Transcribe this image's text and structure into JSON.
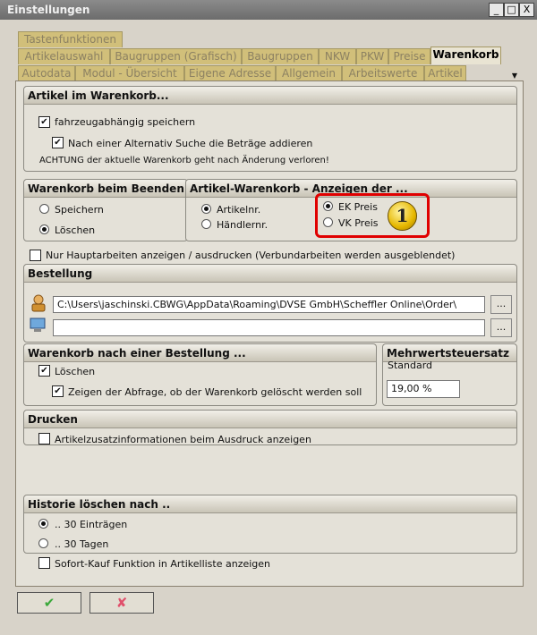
{
  "window": {
    "title": "Einstellungen",
    "controls": [
      "_",
      "□",
      "X"
    ]
  },
  "tabs": {
    "row1": [
      "Tastenfunktionen"
    ],
    "row2": [
      "Artikelauswahl",
      "Baugruppen (Grafisch)",
      "Baugruppen",
      "NKW",
      "PKW",
      "Preise",
      "Warenkorb"
    ],
    "row3": [
      "Autodata",
      "Modul - Übersicht",
      "Eigene Adresse",
      "Allgemein",
      "Arbeitswerte",
      "Artikel"
    ],
    "active": "Warenkorb"
  },
  "artikel_im_warenkorb": {
    "title": "Artikel im Warenkorb...",
    "fahrzeug": {
      "label": "fahrzeugabhängig speichern",
      "checked": true
    },
    "alternativ": {
      "label": "Nach einer Alternativ Suche die Beträge addieren",
      "checked": true
    },
    "warning": "ACHTUNG der aktuelle Warenkorb geht nach Änderung verloren!"
  },
  "warenkorb_beenden": {
    "title": "Warenkorb beim Beenden ...",
    "speichern": "Speichern",
    "loeschen": "Löschen",
    "selected": "Löschen"
  },
  "artikel_warenkorb_anzeige": {
    "title": "Artikel-Warenkorb - Anzeigen der  ...",
    "artikelnr": "Artikelnr.",
    "haendlernr": "Händlernr.",
    "ek": "EK Preis",
    "vk": "VK Preis",
    "badge": "1"
  },
  "nur_haupt": {
    "label": "Nur Hauptarbeiten anzeigen / ausdrucken (Verbundarbeiten werden ausgeblendet)",
    "checked": false
  },
  "bestellung": {
    "title": "Bestellung",
    "path": "C:\\Users\\jaschinski.CBWG\\AppData\\Roaming\\DVSE GmbH\\Scheffler Online\\Order\\",
    "path2": "",
    "browse": "..."
  },
  "nach_bestellung": {
    "title": "Warenkorb nach einer Bestellung ...",
    "loeschen": {
      "label": "Löschen",
      "checked": true
    },
    "abfrage": {
      "label": "Zeigen der Abfrage, ob der Warenkorb gelöscht werden soll",
      "checked": true
    }
  },
  "mwst": {
    "title": "Mehrwertsteuersatz",
    "standard": "Standard",
    "value": "19,00  %"
  },
  "drucken": {
    "title": "Drucken",
    "zusatz": {
      "label": "Artikelzusatzinformationen beim Ausdruck anzeigen",
      "checked": false
    }
  },
  "historie": {
    "title": "Historie löschen nach ..",
    "opt1": ".. 30 Einträgen",
    "opt2": ".. 30 Tagen",
    "selected": ".. 30 Einträgen"
  },
  "sofort": {
    "label": "Sofort-Kauf Funktion in Artikelliste anzeigen",
    "checked": false
  },
  "buttons": {
    "ok": "✔",
    "cancel": "✘"
  },
  "check_mark": "✔",
  "colors": {
    "tab_inactive": "#d1bf7a",
    "highlight": "#e00000",
    "ok": "#3aa83a",
    "cancel": "#e0506b"
  }
}
